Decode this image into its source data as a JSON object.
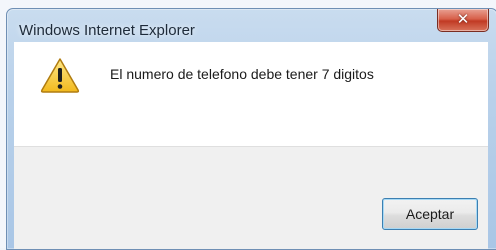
{
  "window": {
    "title": "Windows Internet Explorer",
    "close_icon": "close-icon"
  },
  "dialog": {
    "icon": "warning-icon",
    "message": "El numero de telefono debe tener 7 digitos",
    "ok_label": "Aceptar"
  },
  "colors": {
    "titlebar": "#b9d1ea",
    "close_button": "#d7604a",
    "content_bg": "#ffffff",
    "footer_bg": "#f0f0f0",
    "button_border": "#3c7fb1"
  }
}
